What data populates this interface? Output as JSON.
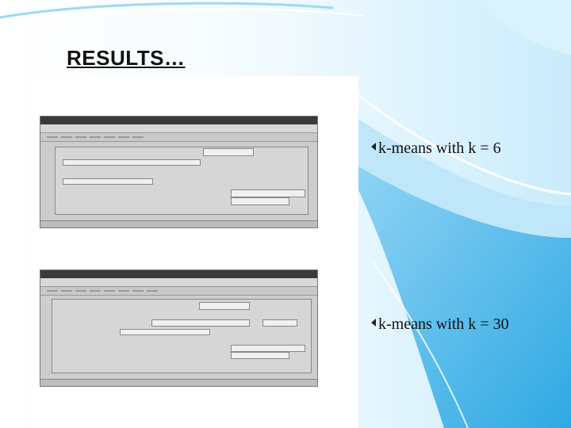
{
  "slide": {
    "title": "RESULTS…",
    "bullets": [
      {
        "text": "k-means with k = 6"
      },
      {
        "text": "k-means with k = 30"
      }
    ]
  },
  "colors": {
    "accent_blue": "#4fb8ea",
    "light_blue": "#cfeefc",
    "swoosh_white": "#ffffff"
  }
}
